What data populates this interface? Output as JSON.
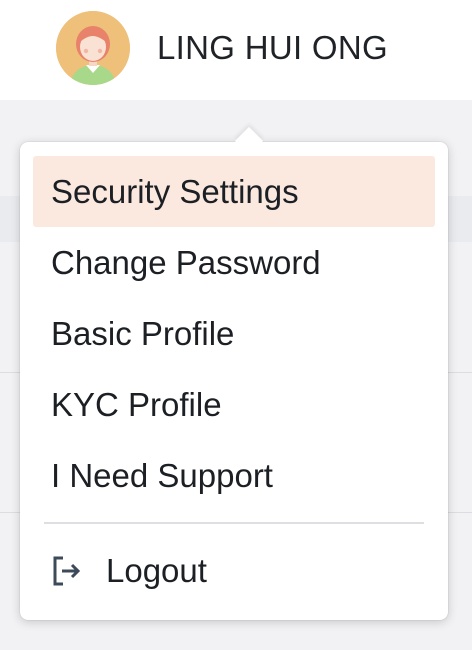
{
  "user": {
    "name": "LING HUI ONG"
  },
  "menu": {
    "items": [
      {
        "label": "Security Settings",
        "active": true
      },
      {
        "label": "Change Password",
        "active": false
      },
      {
        "label": "Basic Profile",
        "active": false
      },
      {
        "label": "KYC Profile",
        "active": false
      },
      {
        "label": "I Need Support",
        "active": false
      }
    ],
    "logout_label": "Logout"
  },
  "icons": {
    "avatar": "avatar-person-icon",
    "logout": "logout-arrow-icon"
  },
  "colors": {
    "active_item_bg": "#fbe9e0",
    "avatar_bg": "#eec07a",
    "text": "#1c1f23",
    "icon": "#3d4a5a"
  }
}
